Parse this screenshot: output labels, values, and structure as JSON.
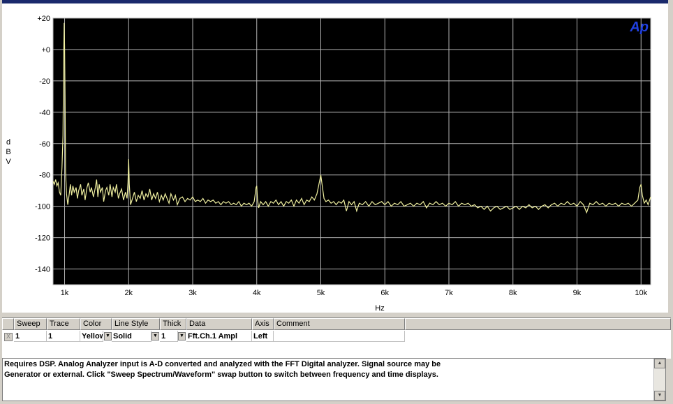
{
  "chart_data": {
    "type": "line",
    "title": "",
    "xlabel": "Hz",
    "ylabel": "dBV",
    "ylabel_chars": [
      "d",
      "B",
      "V"
    ],
    "logo": "Ap",
    "xlim": [
      820,
      10150
    ],
    "ylim": [
      -150,
      20
    ],
    "x_ticks": [
      {
        "value": 1000,
        "label": "1k"
      },
      {
        "value": 2000,
        "label": "2k"
      },
      {
        "value": 3000,
        "label": "3k"
      },
      {
        "value": 4000,
        "label": "4k"
      },
      {
        "value": 5000,
        "label": "5k"
      },
      {
        "value": 6000,
        "label": "6k"
      },
      {
        "value": 7000,
        "label": "7k"
      },
      {
        "value": 8000,
        "label": "8k"
      },
      {
        "value": 9000,
        "label": "9k"
      },
      {
        "value": 10000,
        "label": "10k"
      }
    ],
    "y_ticks": [
      {
        "value": 20,
        "label": "+20"
      },
      {
        "value": 0,
        "label": "+0"
      },
      {
        "value": -20,
        "label": "-20"
      },
      {
        "value": -40,
        "label": "-40"
      },
      {
        "value": -60,
        "label": "-60"
      },
      {
        "value": -80,
        "label": "-80"
      },
      {
        "value": -100,
        "label": "-100"
      },
      {
        "value": -120,
        "label": "-120"
      },
      {
        "value": -140,
        "label": "-140"
      }
    ],
    "grid": true,
    "background": "#000000",
    "grid_color": "#b4b4b4",
    "series": [
      {
        "color": "#f0f0a0",
        "points": [
          [
            820,
            -84
          ],
          [
            840,
            -86
          ],
          [
            860,
            -83
          ],
          [
            880,
            -87
          ],
          [
            900,
            -85
          ],
          [
            920,
            -91
          ],
          [
            940,
            -93
          ],
          [
            960,
            -75
          ],
          [
            975,
            -55
          ],
          [
            985,
            -10
          ],
          [
            993,
            17
          ],
          [
            1000,
            2
          ],
          [
            1007,
            -30
          ],
          [
            1015,
            -78
          ],
          [
            1030,
            -92
          ],
          [
            1050,
            -99
          ],
          [
            1070,
            -93
          ],
          [
            1090,
            -86
          ],
          [
            1110,
            -93
          ],
          [
            1130,
            -87
          ],
          [
            1150,
            -91
          ],
          [
            1180,
            -88
          ],
          [
            1200,
            -95
          ],
          [
            1220,
            -90
          ],
          [
            1250,
            -86
          ],
          [
            1270,
            -93
          ],
          [
            1300,
            -89
          ],
          [
            1320,
            -96
          ],
          [
            1350,
            -88
          ],
          [
            1370,
            -85
          ],
          [
            1400,
            -91
          ],
          [
            1420,
            -88
          ],
          [
            1450,
            -94
          ],
          [
            1480,
            -88
          ],
          [
            1500,
            -83
          ],
          [
            1520,
            -94
          ],
          [
            1540,
            -86
          ],
          [
            1560,
            -91
          ],
          [
            1590,
            -88
          ],
          [
            1610,
            -97
          ],
          [
            1640,
            -90
          ],
          [
            1660,
            -88
          ],
          [
            1690,
            -93
          ],
          [
            1710,
            -86
          ],
          [
            1740,
            -94
          ],
          [
            1760,
            -88
          ],
          [
            1790,
            -91
          ],
          [
            1810,
            -86
          ],
          [
            1840,
            -95
          ],
          [
            1860,
            -92
          ],
          [
            1890,
            -89
          ],
          [
            1920,
            -96
          ],
          [
            1950,
            -91
          ],
          [
            1975,
            -95
          ],
          [
            1990,
            -85
          ],
          [
            2000,
            -70
          ],
          [
            2010,
            -86
          ],
          [
            2030,
            -99
          ],
          [
            2060,
            -95
          ],
          [
            2090,
            -91
          ],
          [
            2120,
            -97
          ],
          [
            2150,
            -93
          ],
          [
            2180,
            -95
          ],
          [
            2210,
            -90
          ],
          [
            2240,
            -96
          ],
          [
            2270,
            -92
          ],
          [
            2300,
            -94
          ],
          [
            2330,
            -89
          ],
          [
            2360,
            -96
          ],
          [
            2390,
            -92
          ],
          [
            2420,
            -95
          ],
          [
            2450,
            -91
          ],
          [
            2480,
            -97
          ],
          [
            2510,
            -93
          ],
          [
            2540,
            -96
          ],
          [
            2570,
            -92
          ],
          [
            2600,
            -95
          ],
          [
            2630,
            -98
          ],
          [
            2660,
            -92
          ],
          [
            2700,
            -96
          ],
          [
            2730,
            -93
          ],
          [
            2760,
            -99
          ],
          [
            2800,
            -95
          ],
          [
            2840,
            -94
          ],
          [
            2880,
            -97
          ],
          [
            2920,
            -95
          ],
          [
            2960,
            -96
          ],
          [
            3000,
            -94
          ],
          [
            3040,
            -97
          ],
          [
            3080,
            -96
          ],
          [
            3120,
            -97
          ],
          [
            3160,
            -95
          ],
          [
            3200,
            -98
          ],
          [
            3240,
            -96
          ],
          [
            3280,
            -97
          ],
          [
            3320,
            -96
          ],
          [
            3360,
            -98
          ],
          [
            3400,
            -97
          ],
          [
            3440,
            -99
          ],
          [
            3480,
            -97
          ],
          [
            3520,
            -98
          ],
          [
            3560,
            -97
          ],
          [
            3600,
            -99
          ],
          [
            3640,
            -98
          ],
          [
            3680,
            -99
          ],
          [
            3720,
            -97
          ],
          [
            3760,
            -100
          ],
          [
            3800,
            -98
          ],
          [
            3840,
            -99
          ],
          [
            3880,
            -98
          ],
          [
            3920,
            -100
          ],
          [
            3960,
            -97
          ],
          [
            3990,
            -88
          ],
          [
            4000,
            -87
          ],
          [
            4010,
            -95
          ],
          [
            4030,
            -101
          ],
          [
            4060,
            -97
          ],
          [
            4100,
            -99
          ],
          [
            4140,
            -97
          ],
          [
            4180,
            -100
          ],
          [
            4220,
            -97
          ],
          [
            4260,
            -98
          ],
          [
            4300,
            -96
          ],
          [
            4340,
            -99
          ],
          [
            4380,
            -97
          ],
          [
            4420,
            -100
          ],
          [
            4460,
            -97
          ],
          [
            4500,
            -98
          ],
          [
            4540,
            -96
          ],
          [
            4580,
            -100
          ],
          [
            4620,
            -96
          ],
          [
            4660,
            -98
          ],
          [
            4700,
            -95
          ],
          [
            4740,
            -99
          ],
          [
            4780,
            -96
          ],
          [
            4820,
            -97
          ],
          [
            4860,
            -94
          ],
          [
            4900,
            -96
          ],
          [
            4940,
            -92
          ],
          [
            4970,
            -86
          ],
          [
            5000,
            -80
          ],
          [
            5020,
            -86
          ],
          [
            5050,
            -95
          ],
          [
            5080,
            -97
          ],
          [
            5120,
            -96
          ],
          [
            5160,
            -98
          ],
          [
            5200,
            -97
          ],
          [
            5240,
            -99
          ],
          [
            5280,
            -97
          ],
          [
            5320,
            -98
          ],
          [
            5360,
            -96
          ],
          [
            5400,
            -103
          ],
          [
            5440,
            -97
          ],
          [
            5480,
            -99
          ],
          [
            5520,
            -97
          ],
          [
            5560,
            -103
          ],
          [
            5600,
            -98
          ],
          [
            5650,
            -99
          ],
          [
            5700,
            -97
          ],
          [
            5750,
            -100
          ],
          [
            5800,
            -97
          ],
          [
            5850,
            -99
          ],
          [
            5900,
            -98
          ],
          [
            5950,
            -97
          ],
          [
            6000,
            -99
          ],
          [
            6050,
            -97
          ],
          [
            6100,
            -100
          ],
          [
            6150,
            -98
          ],
          [
            6200,
            -99
          ],
          [
            6250,
            -97
          ],
          [
            6300,
            -100
          ],
          [
            6350,
            -99
          ],
          [
            6400,
            -98
          ],
          [
            6450,
            -100
          ],
          [
            6500,
            -98
          ],
          [
            6550,
            -99
          ],
          [
            6600,
            -97
          ],
          [
            6650,
            -101
          ],
          [
            6700,
            -98
          ],
          [
            6750,
            -99
          ],
          [
            6800,
            -97
          ],
          [
            6850,
            -99
          ],
          [
            6900,
            -98
          ],
          [
            6950,
            -100
          ],
          [
            7000,
            -98
          ],
          [
            7050,
            -99
          ],
          [
            7100,
            -97
          ],
          [
            7150,
            -100
          ],
          [
            7200,
            -98
          ],
          [
            7250,
            -99
          ],
          [
            7300,
            -98
          ],
          [
            7350,
            -100
          ],
          [
            7400,
            -99
          ],
          [
            7450,
            -101
          ],
          [
            7500,
            -100
          ],
          [
            7550,
            -102
          ],
          [
            7600,
            -100
          ],
          [
            7650,
            -103
          ],
          [
            7700,
            -101
          ],
          [
            7750,
            -100
          ],
          [
            7800,
            -102
          ],
          [
            7850,
            -101
          ],
          [
            7900,
            -100
          ],
          [
            7950,
            -102
          ],
          [
            8000,
            -101
          ],
          [
            8050,
            -100
          ],
          [
            8100,
            -102
          ],
          [
            8150,
            -100
          ],
          [
            8200,
            -101
          ],
          [
            8250,
            -99
          ],
          [
            8300,
            -101
          ],
          [
            8350,
            -100
          ],
          [
            8400,
            -102
          ],
          [
            8450,
            -100
          ],
          [
            8500,
            -99
          ],
          [
            8550,
            -101
          ],
          [
            8600,
            -99
          ],
          [
            8650,
            -98
          ],
          [
            8700,
            -100
          ],
          [
            8750,
            -98
          ],
          [
            8800,
            -99
          ],
          [
            8850,
            -97
          ],
          [
            8900,
            -99
          ],
          [
            8950,
            -98
          ],
          [
            9000,
            -100
          ],
          [
            9050,
            -97
          ],
          [
            9100,
            -99
          ],
          [
            9150,
            -104
          ],
          [
            9200,
            -98
          ],
          [
            9250,
            -99
          ],
          [
            9300,
            -97
          ],
          [
            9350,
            -99
          ],
          [
            9400,
            -98
          ],
          [
            9450,
            -100
          ],
          [
            9500,
            -98
          ],
          [
            9550,
            -99
          ],
          [
            9600,
            -98
          ],
          [
            9650,
            -100
          ],
          [
            9700,
            -98
          ],
          [
            9750,
            -99
          ],
          [
            9800,
            -98
          ],
          [
            9850,
            -100
          ],
          [
            9900,
            -98
          ],
          [
            9950,
            -96
          ],
          [
            9980,
            -88
          ],
          [
            10000,
            -86
          ],
          [
            10020,
            -93
          ],
          [
            10050,
            -98
          ],
          [
            10080,
            -96
          ],
          [
            10110,
            -99
          ],
          [
            10150,
            -94
          ]
        ]
      }
    ]
  },
  "legend": {
    "headers": {
      "sweep": "Sweep",
      "trace": "Trace",
      "color": "Color",
      "line_style": "Line Style",
      "thick": "Thick",
      "data": "Data",
      "axis": "Axis",
      "comment": "Comment"
    },
    "row": {
      "checkbox": "X",
      "sweep": "1",
      "trace": "1",
      "color": "Yellow",
      "line_style": "Solid",
      "thick": "1",
      "data": "Fft.Ch.1 Ampl",
      "axis": "Left",
      "comment": ""
    }
  },
  "comment": {
    "line1": "Requires DSP.  Analog Analyzer input is A-D converted and analyzed with the FFT Digital analyzer.  Signal source may be",
    "line2": "Generator or external.  Click \"Sweep Spectrum/Waveform\" swap button to switch between frequency and time displays."
  },
  "colors": {
    "plot_bg": "#000000",
    "trace": "#f0f0a0",
    "logo": "#2040e0",
    "window_chrome": "#d4d0c8"
  }
}
